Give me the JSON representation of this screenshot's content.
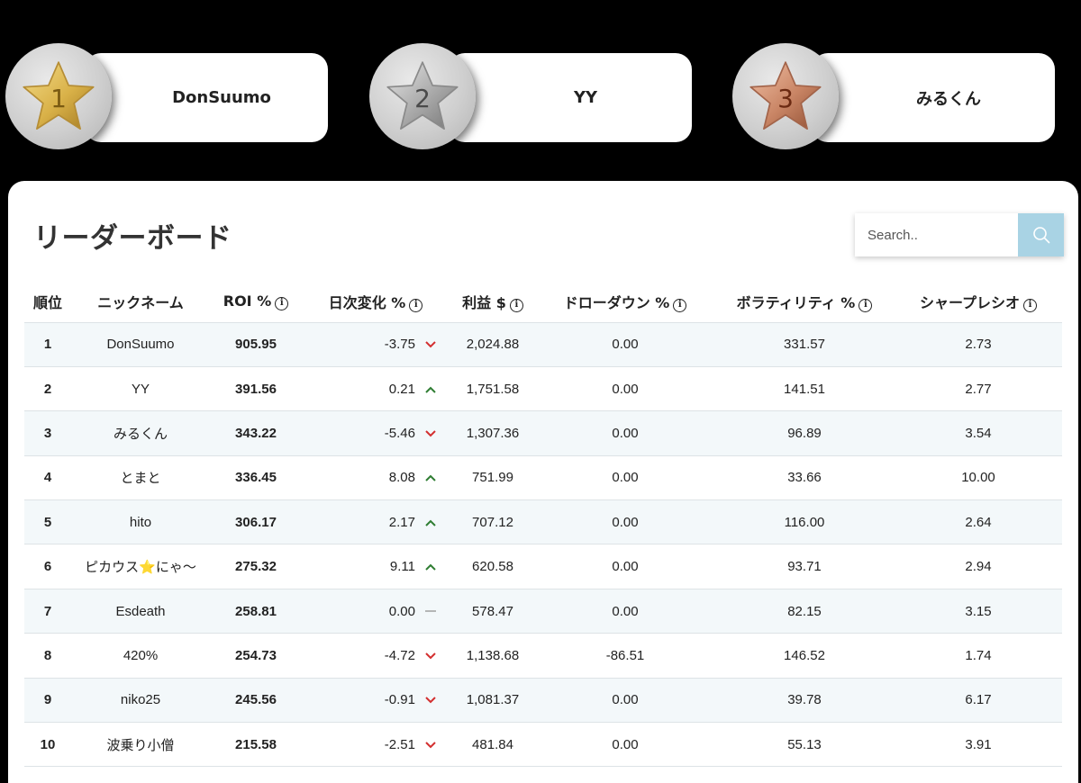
{
  "podium": [
    {
      "rank": "1",
      "name": "DonSuumo",
      "medal": "gold"
    },
    {
      "rank": "2",
      "name": "YY",
      "medal": "silver"
    },
    {
      "rank": "3",
      "name": "みるくん",
      "medal": "bronze"
    }
  ],
  "leaderboard": {
    "title": "リーダーボード",
    "search_placeholder": "Search..",
    "columns": [
      "順位",
      "ニックネーム",
      "ROI %",
      "日次変化 %",
      "利益 $",
      "ドローダウン %",
      "ボラティリティ %",
      "シャープレシオ"
    ],
    "rows": [
      {
        "rank": "1",
        "nickname": "DonSuumo",
        "roi": "905.95",
        "daily": "-3.75",
        "trend": "down",
        "profit": "2,024.88",
        "drawdown": "0.00",
        "volatility": "331.57",
        "sharpe": "2.73"
      },
      {
        "rank": "2",
        "nickname": "YY",
        "roi": "391.56",
        "daily": "0.21",
        "trend": "up",
        "profit": "1,751.58",
        "drawdown": "0.00",
        "volatility": "141.51",
        "sharpe": "2.77"
      },
      {
        "rank": "3",
        "nickname": "みるくん",
        "roi": "343.22",
        "daily": "-5.46",
        "trend": "down",
        "profit": "1,307.36",
        "drawdown": "0.00",
        "volatility": "96.89",
        "sharpe": "3.54"
      },
      {
        "rank": "4",
        "nickname": "とまと",
        "roi": "336.45",
        "daily": "8.08",
        "trend": "up",
        "profit": "751.99",
        "drawdown": "0.00",
        "volatility": "33.66",
        "sharpe": "10.00"
      },
      {
        "rank": "5",
        "nickname": "hito",
        "roi": "306.17",
        "daily": "2.17",
        "trend": "up",
        "profit": "707.12",
        "drawdown": "0.00",
        "volatility": "116.00",
        "sharpe": "2.64"
      },
      {
        "rank": "6",
        "nickname": "ピカウス⭐にゃ〜",
        "roi": "275.32",
        "daily": "9.11",
        "trend": "up",
        "profit": "620.58",
        "drawdown": "0.00",
        "volatility": "93.71",
        "sharpe": "2.94"
      },
      {
        "rank": "7",
        "nickname": "Esdeath",
        "roi": "258.81",
        "daily": "0.00",
        "trend": "flat",
        "profit": "578.47",
        "drawdown": "0.00",
        "volatility": "82.15",
        "sharpe": "3.15"
      },
      {
        "rank": "8",
        "nickname": "420%",
        "roi": "254.73",
        "daily": "-4.72",
        "trend": "down",
        "profit": "1,138.68",
        "drawdown": "-86.51",
        "volatility": "146.52",
        "sharpe": "1.74"
      },
      {
        "rank": "9",
        "nickname": "niko25",
        "roi": "245.56",
        "daily": "-0.91",
        "trend": "down",
        "profit": "1,081.37",
        "drawdown": "0.00",
        "volatility": "39.78",
        "sharpe": "6.17"
      },
      {
        "rank": "10",
        "nickname": "波乗り小僧",
        "roi": "215.58",
        "daily": "-2.51",
        "trend": "down",
        "profit": "481.84",
        "drawdown": "0.00",
        "volatility": "55.13",
        "sharpe": "3.91"
      }
    ]
  },
  "colors": {
    "gold": "#d9b148",
    "silver": "#a9a9a9",
    "bronze": "#c98565",
    "up_arrow": "#2e7d32",
    "down_arrow": "#d32f2f",
    "flat_dash": "#999999",
    "search_button": "#a9d3e4",
    "row_stripe": "#f3f8fa"
  }
}
